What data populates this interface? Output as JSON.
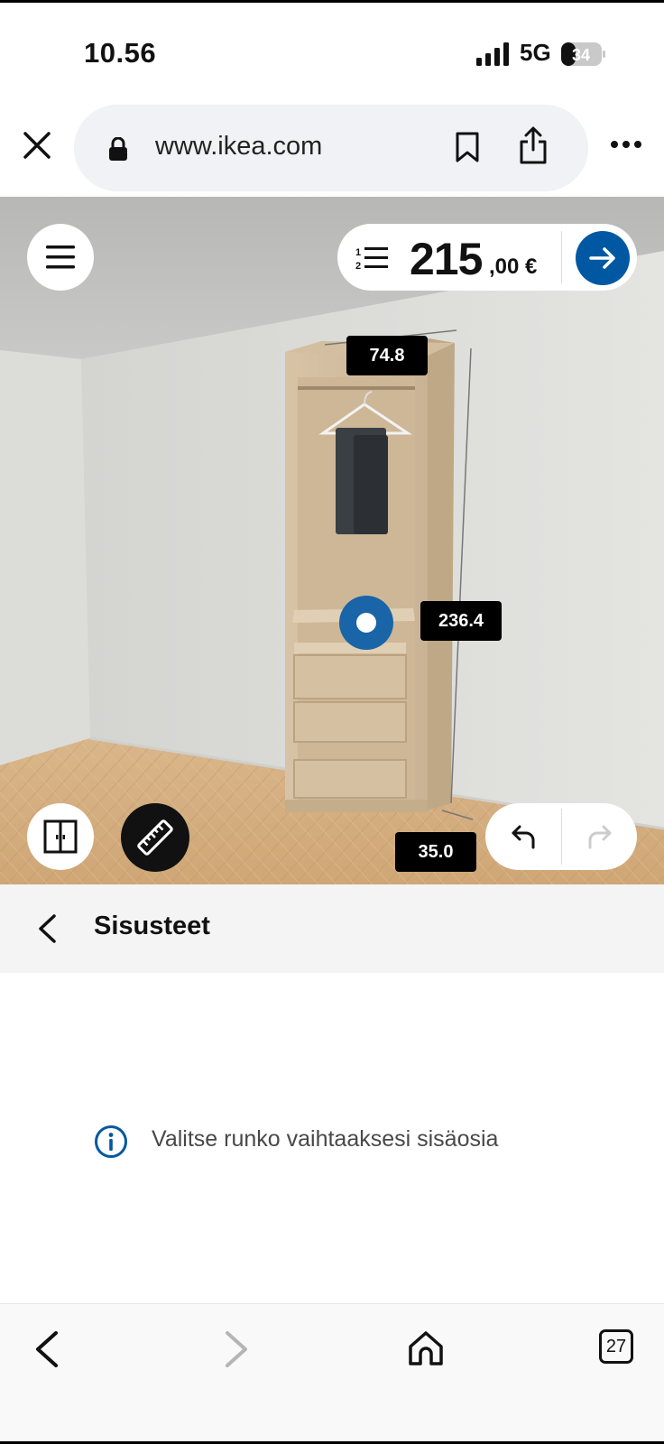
{
  "status_bar": {
    "time": "10.56",
    "network": "5G",
    "battery": "34"
  },
  "browser": {
    "url": "www.ikea.com",
    "icons": [
      "close-icon",
      "lock-icon",
      "bookmark-icon",
      "share-icon",
      "more-icon"
    ]
  },
  "planner": {
    "price_main": "215",
    "price_decimals": ",00 €",
    "dimensions": {
      "width": "74.8",
      "height": "236.4",
      "depth": "35.0"
    },
    "icons": [
      "menu-icon",
      "numbered-list-icon",
      "arrow-right-icon",
      "doors-icon",
      "ruler-icon",
      "undo-icon",
      "redo-icon"
    ]
  },
  "section": {
    "title": "Sisusteet",
    "info_text": "Valitse runko vaihtaaksesi sisäosia"
  },
  "bottom_nav": {
    "tab_count": "27",
    "icons": [
      "back-arrow-icon",
      "forward-arrow-icon",
      "home-icon",
      "tabs-icon"
    ]
  },
  "colors": {
    "ikea_blue": "#0058a3",
    "handle_blue": "#1a64a8"
  }
}
